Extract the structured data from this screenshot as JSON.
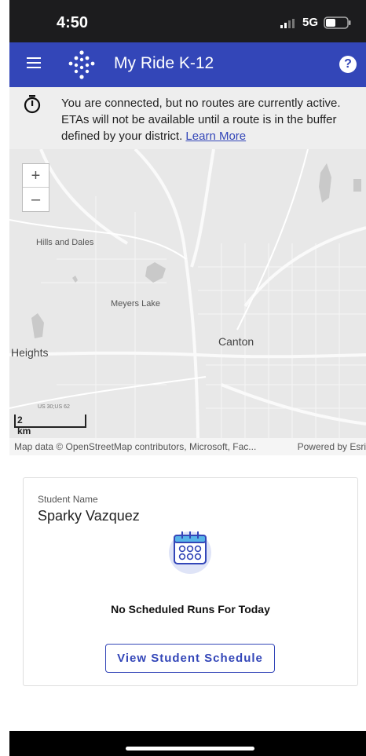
{
  "status_bar": {
    "time": "4:50",
    "network": "5G",
    "icons": [
      "signal-icon",
      "battery-icon"
    ]
  },
  "app_bar": {
    "title": "My Ride K-12",
    "help_glyph": "?",
    "icons": [
      "menu-icon",
      "logo-icon",
      "help-icon"
    ],
    "color": "#3346b8"
  },
  "notice": {
    "message": "You are connected, but no routes are currently active. ETAs will not be available until a route is in the buffer defined by your district.",
    "link": "Learn More",
    "icon": "stopwatch-icon"
  },
  "map": {
    "zoom_in": "+",
    "zoom_out": "–",
    "labels": {
      "hills_and_dales": "Hills and Dales",
      "meyers_lake": "Meyers Lake",
      "canton": "Canton",
      "heights": "Heights"
    },
    "scale_road": "US 30;US 62",
    "scale": "2 km",
    "attribution": "Map data © OpenStreetMap contributors, Microsoft, Fac...",
    "powered_by": "Powered by Esri"
  },
  "student_card": {
    "label": "Student Name",
    "name": "Sparky Vazquez",
    "icon": "calendar-icon",
    "no_runs": "No Scheduled Runs For Today",
    "button": "View Student Schedule"
  }
}
